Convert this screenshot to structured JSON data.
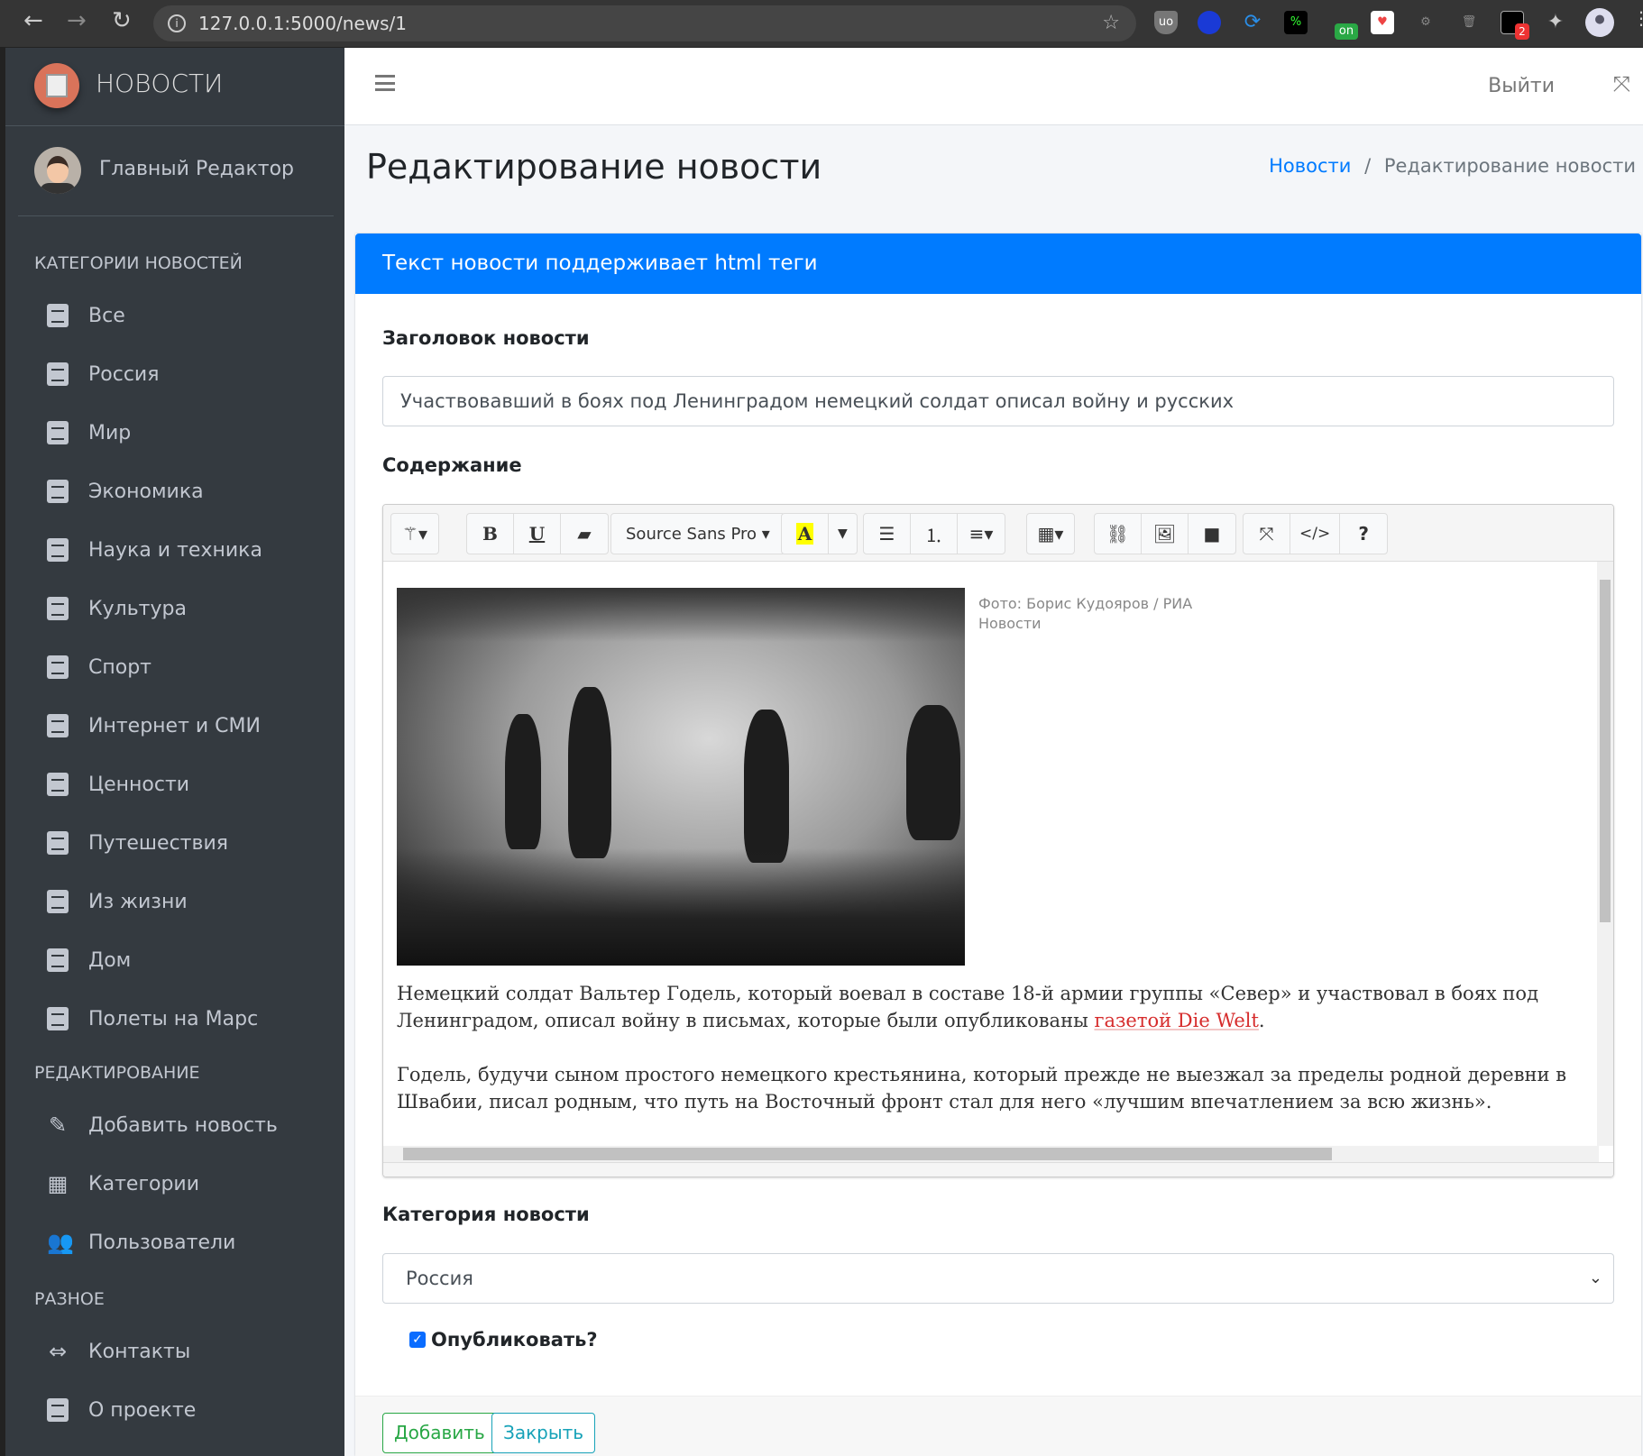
{
  "browser": {
    "url": "127.0.0.1:5000/news/1",
    "ext_badge": "2",
    "ext_on": "on"
  },
  "sidebar": {
    "brand": "НОВОСТИ",
    "user": "Главный Редактор",
    "section_categories": "КАТЕГОРИИ НОВОСТЕЙ",
    "categories": [
      "Все",
      "Россия",
      "Мир",
      "Экономика",
      "Наука и техника",
      "Культура",
      "Спорт",
      "Интернет и СМИ",
      "Ценности",
      "Путешествия",
      "Из жизни",
      "Дом",
      "Полеты на Марс"
    ],
    "section_edit": "РЕДАКТИРОВАНИЕ",
    "edit_items": [
      {
        "label": "Добавить новость",
        "icon": "edit-icon"
      },
      {
        "label": "Категории",
        "icon": "grid-icon"
      },
      {
        "label": "Пользователи",
        "icon": "users-icon"
      }
    ],
    "section_misc": "РАЗНОЕ",
    "misc_items": [
      {
        "label": "Контакты",
        "icon": "contacts-icon"
      },
      {
        "label": "О проекте",
        "icon": "address-book-icon"
      }
    ]
  },
  "topnav": {
    "logout": "Выйти"
  },
  "page": {
    "title": "Редактирование новости",
    "breadcrumb": {
      "link": "Новости",
      "sep": "/",
      "current": "Редактирование новости"
    }
  },
  "card": {
    "header": "Текст новости поддерживает html теги",
    "title_label": "Заголовок новости",
    "title_value": "Участвовавший в боях под Ленинградом немецкий солдат описал войну и русских",
    "content_label": "Содержание",
    "toolbar": {
      "font": "Source Sans Pro",
      "bold": "B",
      "underline": "U",
      "color": "A",
      "code": "</>",
      "help": "?"
    },
    "content": {
      "caption": "Фото: Борис Кудояров / РИА Новости",
      "p1_text": "Немецкий солдат Вальтер Годель, который воевал в составе 18-й армии группы «Север» и участвовал в боях под Ленинградом, описал войну в письмах, которые были опубликованы ",
      "p1_link": "газетой Die Welt",
      "p1_end": ".",
      "p2": "Годель, будучи сыном простого немецкого крестьянина, который прежде не выезжал за пределы родной деревни в Швабии, писал родным, что путь на Восточный фронт стал для него «лучшим впечатлением за всю жизнь»."
    },
    "category_label": "Категория новости",
    "category_value": "Россия",
    "publish_label": "Опубликовать?",
    "publish_checked": true,
    "add_button": "Добавить",
    "close_button": "Закрыть"
  },
  "colors": {
    "primary": "#007bff",
    "sidebar": "#343a40",
    "success": "#28a745",
    "info": "#17a2b8"
  }
}
